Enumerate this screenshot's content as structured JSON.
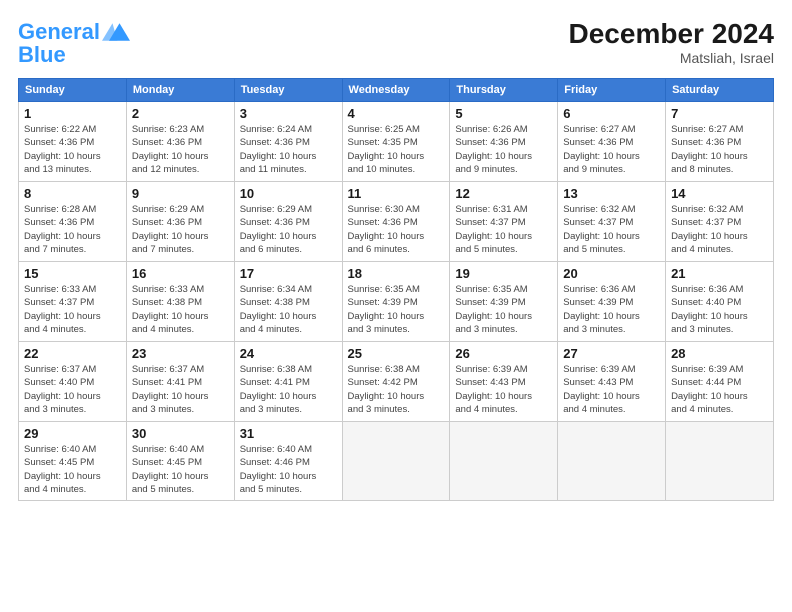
{
  "logo": {
    "line1": "General",
    "line2": "Blue"
  },
  "title": "December 2024",
  "location": "Matsliah, Israel",
  "weekdays": [
    "Sunday",
    "Monday",
    "Tuesday",
    "Wednesday",
    "Thursday",
    "Friday",
    "Saturday"
  ],
  "days": [
    {
      "num": "",
      "info": ""
    },
    {
      "num": "",
      "info": ""
    },
    {
      "num": "",
      "info": ""
    },
    {
      "num": "",
      "info": ""
    },
    {
      "num": "",
      "info": ""
    },
    {
      "num": "",
      "info": ""
    },
    {
      "num": "1",
      "info": "Sunrise: 6:22 AM\nSunset: 4:36 PM\nDaylight: 10 hours\nand 13 minutes."
    },
    {
      "num": "2",
      "info": "Sunrise: 6:23 AM\nSunset: 4:36 PM\nDaylight: 10 hours\nand 12 minutes."
    },
    {
      "num": "3",
      "info": "Sunrise: 6:24 AM\nSunset: 4:36 PM\nDaylight: 10 hours\nand 11 minutes."
    },
    {
      "num": "4",
      "info": "Sunrise: 6:25 AM\nSunset: 4:35 PM\nDaylight: 10 hours\nand 10 minutes."
    },
    {
      "num": "5",
      "info": "Sunrise: 6:26 AM\nSunset: 4:36 PM\nDaylight: 10 hours\nand 9 minutes."
    },
    {
      "num": "6",
      "info": "Sunrise: 6:27 AM\nSunset: 4:36 PM\nDaylight: 10 hours\nand 9 minutes."
    },
    {
      "num": "7",
      "info": "Sunrise: 6:27 AM\nSunset: 4:36 PM\nDaylight: 10 hours\nand 8 minutes."
    },
    {
      "num": "8",
      "info": "Sunrise: 6:28 AM\nSunset: 4:36 PM\nDaylight: 10 hours\nand 7 minutes."
    },
    {
      "num": "9",
      "info": "Sunrise: 6:29 AM\nSunset: 4:36 PM\nDaylight: 10 hours\nand 7 minutes."
    },
    {
      "num": "10",
      "info": "Sunrise: 6:29 AM\nSunset: 4:36 PM\nDaylight: 10 hours\nand 6 minutes."
    },
    {
      "num": "11",
      "info": "Sunrise: 6:30 AM\nSunset: 4:36 PM\nDaylight: 10 hours\nand 6 minutes."
    },
    {
      "num": "12",
      "info": "Sunrise: 6:31 AM\nSunset: 4:37 PM\nDaylight: 10 hours\nand 5 minutes."
    },
    {
      "num": "13",
      "info": "Sunrise: 6:32 AM\nSunset: 4:37 PM\nDaylight: 10 hours\nand 5 minutes."
    },
    {
      "num": "14",
      "info": "Sunrise: 6:32 AM\nSunset: 4:37 PM\nDaylight: 10 hours\nand 4 minutes."
    },
    {
      "num": "15",
      "info": "Sunrise: 6:33 AM\nSunset: 4:37 PM\nDaylight: 10 hours\nand 4 minutes."
    },
    {
      "num": "16",
      "info": "Sunrise: 6:33 AM\nSunset: 4:38 PM\nDaylight: 10 hours\nand 4 minutes."
    },
    {
      "num": "17",
      "info": "Sunrise: 6:34 AM\nSunset: 4:38 PM\nDaylight: 10 hours\nand 4 minutes."
    },
    {
      "num": "18",
      "info": "Sunrise: 6:35 AM\nSunset: 4:39 PM\nDaylight: 10 hours\nand 3 minutes."
    },
    {
      "num": "19",
      "info": "Sunrise: 6:35 AM\nSunset: 4:39 PM\nDaylight: 10 hours\nand 3 minutes."
    },
    {
      "num": "20",
      "info": "Sunrise: 6:36 AM\nSunset: 4:39 PM\nDaylight: 10 hours\nand 3 minutes."
    },
    {
      "num": "21",
      "info": "Sunrise: 6:36 AM\nSunset: 4:40 PM\nDaylight: 10 hours\nand 3 minutes."
    },
    {
      "num": "22",
      "info": "Sunrise: 6:37 AM\nSunset: 4:40 PM\nDaylight: 10 hours\nand 3 minutes."
    },
    {
      "num": "23",
      "info": "Sunrise: 6:37 AM\nSunset: 4:41 PM\nDaylight: 10 hours\nand 3 minutes."
    },
    {
      "num": "24",
      "info": "Sunrise: 6:38 AM\nSunset: 4:41 PM\nDaylight: 10 hours\nand 3 minutes."
    },
    {
      "num": "25",
      "info": "Sunrise: 6:38 AM\nSunset: 4:42 PM\nDaylight: 10 hours\nand 3 minutes."
    },
    {
      "num": "26",
      "info": "Sunrise: 6:39 AM\nSunset: 4:43 PM\nDaylight: 10 hours\nand 4 minutes."
    },
    {
      "num": "27",
      "info": "Sunrise: 6:39 AM\nSunset: 4:43 PM\nDaylight: 10 hours\nand 4 minutes."
    },
    {
      "num": "28",
      "info": "Sunrise: 6:39 AM\nSunset: 4:44 PM\nDaylight: 10 hours\nand 4 minutes."
    },
    {
      "num": "29",
      "info": "Sunrise: 6:40 AM\nSunset: 4:45 PM\nDaylight: 10 hours\nand 4 minutes."
    },
    {
      "num": "30",
      "info": "Sunrise: 6:40 AM\nSunset: 4:45 PM\nDaylight: 10 hours\nand 5 minutes."
    },
    {
      "num": "31",
      "info": "Sunrise: 6:40 AM\nSunset: 4:46 PM\nDaylight: 10 hours\nand 5 minutes."
    },
    {
      "num": "",
      "info": ""
    },
    {
      "num": "",
      "info": ""
    },
    {
      "num": "",
      "info": ""
    },
    {
      "num": "",
      "info": ""
    }
  ]
}
